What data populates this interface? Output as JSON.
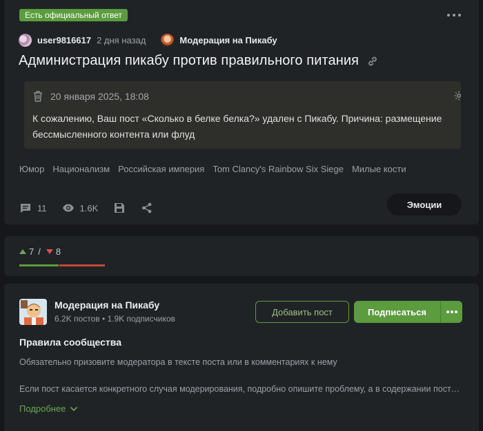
{
  "post": {
    "badge": "Есть официальный ответ",
    "author": "user9816617",
    "time": "2 дня назад",
    "community": "Модерация на Пикабу",
    "title": "Администрация пикабу против правильного питания",
    "notice": {
      "date": "20 января 2025, 18:08",
      "message": "К сожалению, Ваш пост «Сколько в белке белка?» удален с Пикабу. Причина: размещение бессмысленного контента или флуд"
    },
    "tags": [
      "Юмор",
      "Национализм",
      "Российская империя",
      "Tom Clancy's Rainbow Six Siege",
      "Милые кости"
    ],
    "comments": "11",
    "views": "1.6K",
    "emotions_label": "Эмоции"
  },
  "rating": {
    "up": "7",
    "sep": "/",
    "down": "8"
  },
  "community": {
    "name": "Модерация на Пикабу",
    "posts": "6.2K постов",
    "dot": "•",
    "subscribers": "1.9K подписчиков",
    "add_post_label": "Добавить пост",
    "subscribe_label": "Подписаться",
    "rules_title": "Правила сообщества",
    "rules": [
      "Обязательно призовите модератора в тексте поста или в комментариях к нему",
      "Если пост касается конкретного случая модерирования, подробно опишите проблему, а в содержании поста укажите ссылку на материал"
    ],
    "more_label": "Подробнее"
  },
  "colors": {
    "accent": "#5b9c3f",
    "up": "#6aa84f",
    "down": "#d9534f",
    "card": "#202326",
    "background": "#15171a"
  },
  "icons": {
    "comments": "comment-icon",
    "views": "eye-icon",
    "save": "save-icon",
    "share": "share-icon",
    "trash": "trash-icon",
    "gear": "gear-icon",
    "link": "link-icon"
  }
}
